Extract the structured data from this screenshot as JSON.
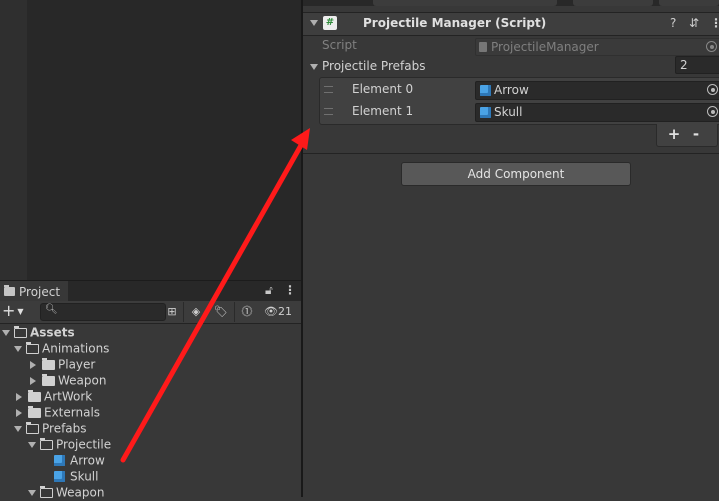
{
  "project": {
    "tab_label": "Project",
    "search": {
      "value": "",
      "placeholder": ""
    },
    "hidden_count": "21",
    "tree": [
      {
        "label": "Assets",
        "indent": 0,
        "expanded": true,
        "kind": "folder",
        "bold": true
      },
      {
        "label": "Animations",
        "indent": 1,
        "expanded": true,
        "kind": "folder"
      },
      {
        "label": "Player",
        "indent": 2,
        "expanded": false,
        "kind": "folder"
      },
      {
        "label": "Weapon",
        "indent": 2,
        "expanded": false,
        "kind": "folder"
      },
      {
        "label": "ArtWork",
        "indent": 1,
        "expanded": false,
        "kind": "folder"
      },
      {
        "label": "Externals",
        "indent": 1,
        "expanded": false,
        "kind": "folder"
      },
      {
        "label": "Prefabs",
        "indent": 1,
        "expanded": true,
        "kind": "folder"
      },
      {
        "label": "Projectile",
        "indent": 2,
        "expanded": true,
        "kind": "folder"
      },
      {
        "label": "Arrow",
        "indent": 3,
        "kind": "prefab"
      },
      {
        "label": "Skull",
        "indent": 3,
        "kind": "prefab"
      },
      {
        "label": "Weapon",
        "indent": 2,
        "expanded": true,
        "kind": "folder"
      }
    ]
  },
  "inspector": {
    "component_title": "Projectile Manager (Script)",
    "script_label": "Script",
    "script_value": "ProjectileManager",
    "list_label": "Projectile Prefabs",
    "list_size": "2",
    "elements": [
      {
        "label": "Element 0",
        "value": "Arrow"
      },
      {
        "label": "Element 1",
        "value": "Skull"
      }
    ],
    "add_symbol": "+",
    "remove_symbol": "-",
    "add_component_label": "Add Component"
  },
  "colors": {
    "arrow": "#ff1a1a",
    "prefab_icon": "#4aa3e6",
    "script_icon_green": "#2e8b3a"
  },
  "icons": {
    "header": [
      "help-icon",
      "presets-icon",
      "kebab-menu-icon"
    ],
    "project_tab": [
      "lock-icon",
      "kebab-menu-icon"
    ]
  }
}
